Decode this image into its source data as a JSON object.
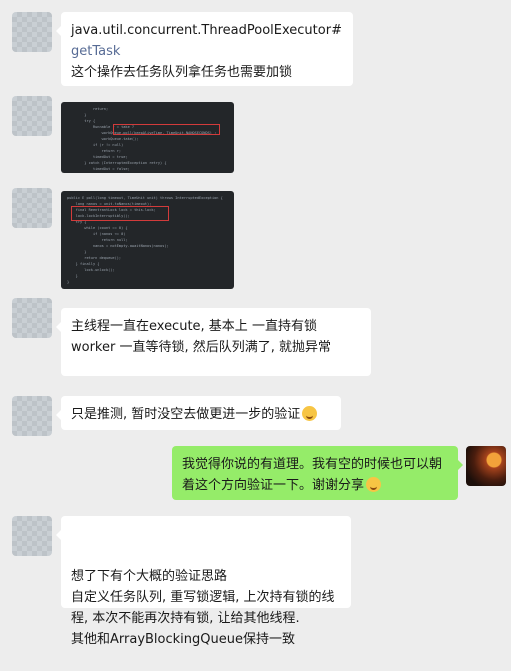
{
  "messages": [
    {
      "id": "m1",
      "side": "left",
      "lines": [
        "java.util.concurrent.ThreadPoolExecutor#",
        "getTask",
        "这个操作去任务队列拿任务也需要加锁"
      ]
    },
    {
      "id": "m2",
      "side": "left",
      "type": "image",
      "alt": "code screenshot 1"
    },
    {
      "id": "m3",
      "side": "left",
      "type": "image",
      "alt": "code screenshot 2"
    },
    {
      "id": "m4",
      "side": "left",
      "text": "主线程一直在execute, 基本上 一直持有锁 worker 一直等待锁, 然后队列满了, 就抛异常"
    },
    {
      "id": "m5",
      "side": "left",
      "text": "只是推测, 暂时没空去做更进一步的验证",
      "emoji": "grin-sweat-emoji"
    },
    {
      "id": "m6",
      "side": "right",
      "text": "我觉得你说的有道理。我有空的时候也可以朝着这个方向验证一下。谢谢分享",
      "emoji": "heart-eyes-emoji"
    },
    {
      "id": "m7",
      "side": "left",
      "text": "想了下有个大概的验证思路\n自定义任务队列, 重写锁逻辑, 上次持有锁的线程, 本次不能再次持有锁, 让给其他线程.\n其他和ArrayBlockingQueue保持一致"
    }
  ]
}
